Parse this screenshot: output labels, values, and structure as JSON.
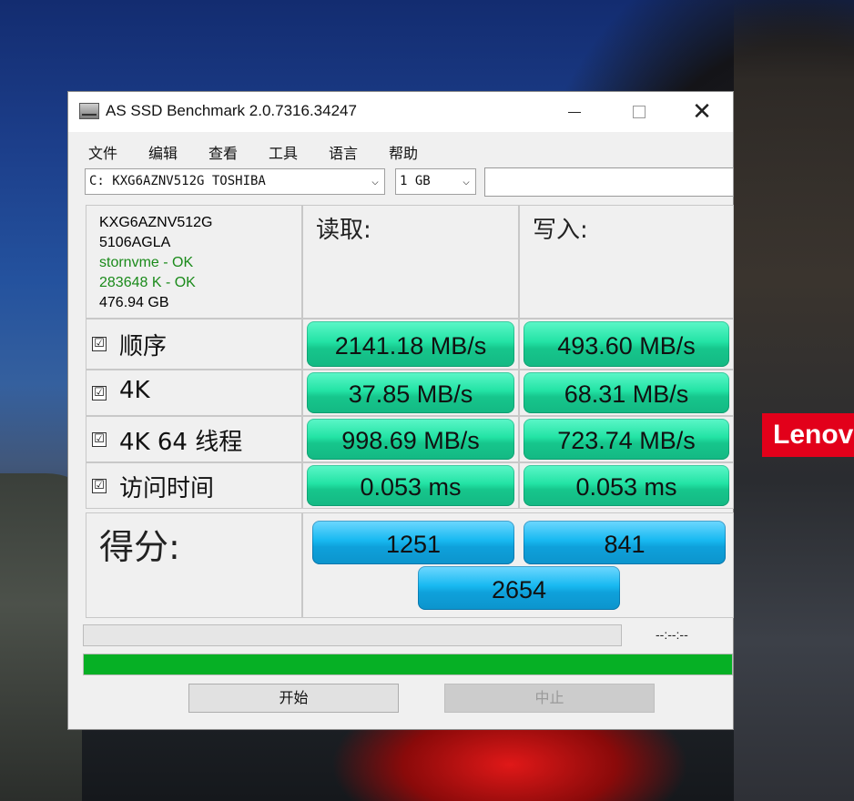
{
  "window": {
    "title": "AS SSD Benchmark 2.0.7316.34247",
    "controls": {
      "minimize": "—",
      "maximize": "□",
      "close": "✕"
    }
  },
  "menu": [
    "文件",
    "编辑",
    "查看",
    "工具",
    "语言",
    "帮助"
  ],
  "drive_select": {
    "value": "C: KXG6AZNV512G TOSHIBA",
    "arrow": "⌵"
  },
  "size_select": {
    "value": "1 GB",
    "arrow": "⌵"
  },
  "drive_info": {
    "model": "KXG6AZNV512G",
    "firmware": "5106AGLA",
    "driver_status": "stornvme - OK",
    "alignment_status": "283648 K - OK",
    "capacity": "476.94 GB"
  },
  "headers": {
    "read": "读取:",
    "write": "写入:"
  },
  "tests": [
    {
      "checked": "☑",
      "label": "顺序",
      "read": "2141.18 MB/s",
      "write": "493.60 MB/s"
    },
    {
      "checked": "☑",
      "label": "4K",
      "read": "37.85 MB/s",
      "write": "68.31 MB/s"
    },
    {
      "checked": "☑",
      "label": "4K 64 线程",
      "read": "998.69 MB/s",
      "write": "723.74 MB/s"
    },
    {
      "checked": "☑",
      "label": "访问时间",
      "read": "0.053 ms",
      "write": "0.053 ms"
    }
  ],
  "score": {
    "label": "得分:",
    "read": "1251",
    "write": "841",
    "total": "2654"
  },
  "progress": {
    "timer": "--:--:--",
    "overall_fraction": 1.0
  },
  "buttons": {
    "start": "开始",
    "abort": "中止"
  },
  "desktop": {
    "brand_logo": "Lenovo",
    "accent_color": "#e2001a"
  }
}
